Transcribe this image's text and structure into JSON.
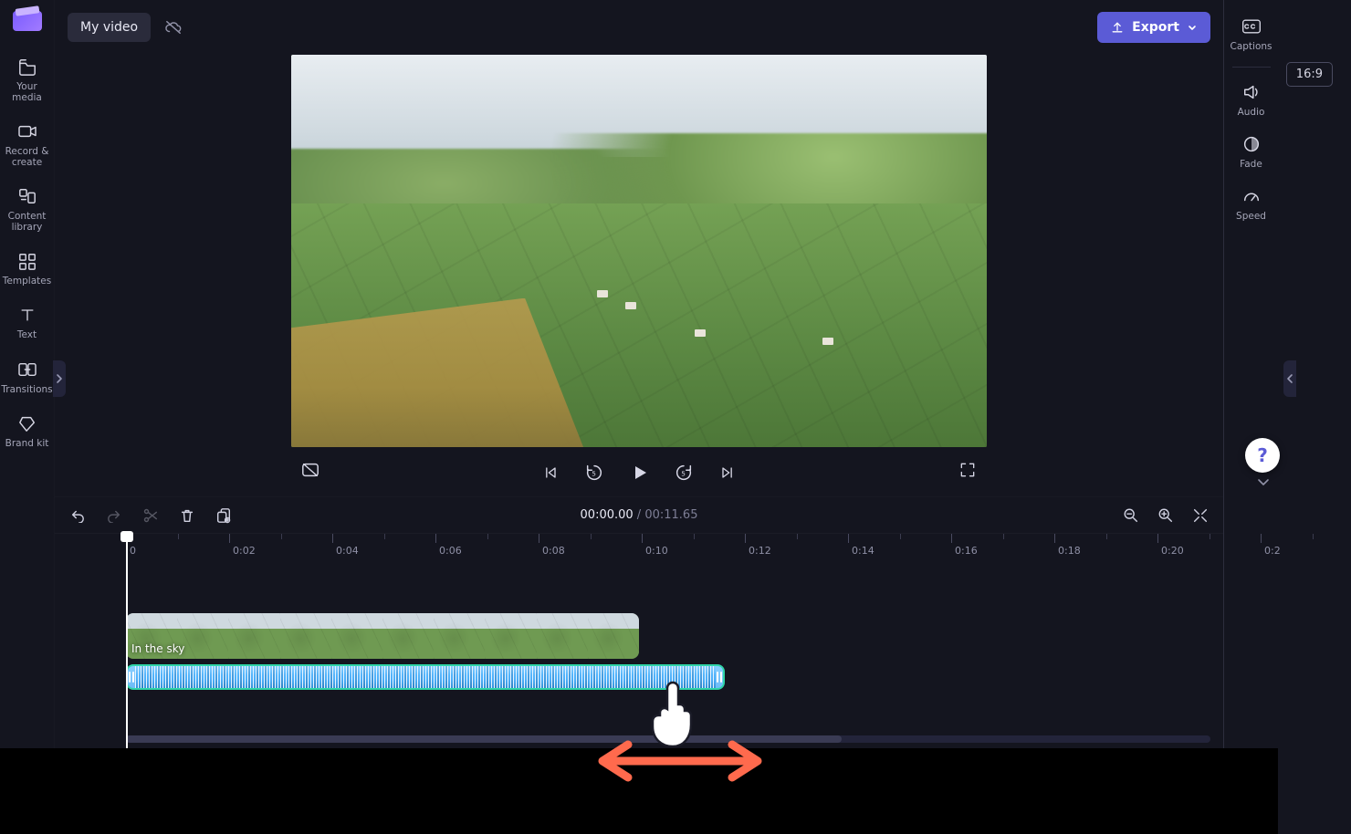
{
  "topbar": {
    "project_title": "My video",
    "export_label": "Export",
    "aspect_ratio": "16:9"
  },
  "left_sidebar": {
    "items": [
      {
        "icon": "media",
        "label": "Your media"
      },
      {
        "icon": "camcorder",
        "label": "Record & create"
      },
      {
        "icon": "library",
        "label": "Content library"
      },
      {
        "icon": "templates",
        "label": "Templates"
      },
      {
        "icon": "text",
        "label": "Text"
      },
      {
        "icon": "transitions",
        "label": "Transitions"
      },
      {
        "icon": "brand",
        "label": "Brand kit"
      }
    ]
  },
  "right_sidebar": {
    "items": [
      {
        "icon": "cc",
        "label": "Captions"
      },
      {
        "icon": "audio",
        "label": "Audio"
      },
      {
        "icon": "fade",
        "label": "Fade"
      },
      {
        "icon": "speed",
        "label": "Speed"
      }
    ]
  },
  "transport": {
    "safezone_tooltip": "Toggle safe zone",
    "fullscreen_tooltip": "Full screen"
  },
  "timeline_toolbar": {
    "current_time": "00:00.00",
    "separator": " / ",
    "duration": "00:11.65"
  },
  "ruler": {
    "origin_label": "0",
    "ticks": [
      "0:02",
      "0:04",
      "0:06",
      "0:08",
      "0:10",
      "0:12",
      "0:14",
      "0:16",
      "0:18",
      "0:20",
      "0:2"
    ]
  },
  "clips": {
    "video_label": "In the sky"
  },
  "help_label": "?"
}
